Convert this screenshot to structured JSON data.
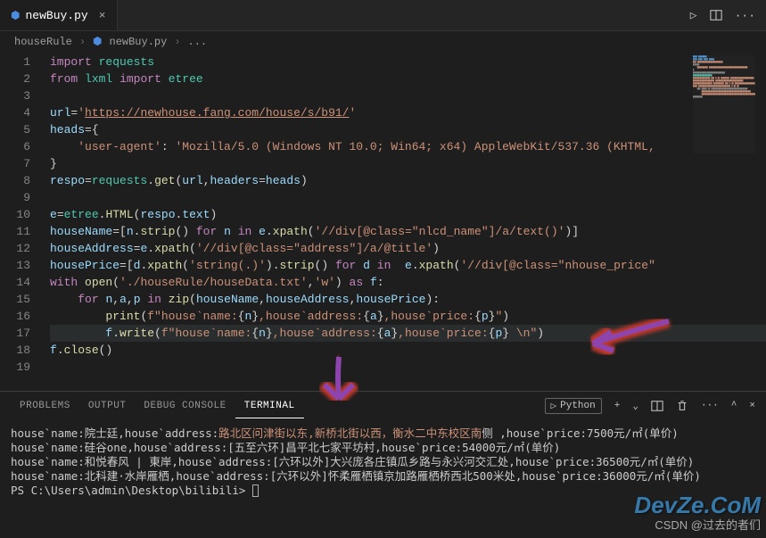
{
  "tab": {
    "filename": "newBuy.py",
    "icon": "python"
  },
  "breadcrumb": {
    "folder": "houseRule",
    "file": "newBuy.py",
    "suffix": "..."
  },
  "code": {
    "lines": [
      {
        "num": "1",
        "html": "<span class='k-import'>import</span> <span class='mod'>requests</span>"
      },
      {
        "num": "2",
        "html": "<span class='k-from'>from</span> <span class='mod'>lxml</span> <span class='k-import'>import</span> <span class='mod'>etree</span>"
      },
      {
        "num": "3",
        "html": ""
      },
      {
        "num": "4",
        "html": "<span class='var'>url</span>=<span class='s-string'>'</span><span class='s-url'>https://newhouse.fang.com/house/s/b91/</span><span class='s-string'>'</span>"
      },
      {
        "num": "5",
        "html": "<span class='var'>heads</span>={"
      },
      {
        "num": "6",
        "html": "    <span class='s-string'>'user-agent'</span>: <span class='s-string'>'Mozilla/5.0 (Windows NT 10.0; Win64; x64) AppleWebKit/537.36 (KHTML,</span>"
      },
      {
        "num": "7",
        "html": "}"
      },
      {
        "num": "8",
        "html": "<span class='var'>respo</span>=<span class='mod'>requests</span>.<span class='fn'>get</span>(<span class='var'>url</span>,<span class='var'>headers</span>=<span class='var'>heads</span>)"
      },
      {
        "num": "9",
        "html": ""
      },
      {
        "num": "10",
        "html": "<span class='var'>e</span>=<span class='mod'>etree</span>.<span class='fn'>HTML</span>(<span class='var'>respo</span>.<span class='var'>text</span>)"
      },
      {
        "num": "11",
        "html": "<span class='var'>houseName</span>=[<span class='var'>n</span>.<span class='fn'>strip</span>() <span class='k-for'>for</span> <span class='var'>n</span> <span class='k-in'>in</span> <span class='var'>e</span>.<span class='fn'>xpath</span>(<span class='s-string'>'//div[@class=\"nlcd_name\"]/a/text()'</span>)]"
      },
      {
        "num": "12",
        "html": "<span class='var'>houseAddress</span>=<span class='var'>e</span>.<span class='fn'>xpath</span>(<span class='s-string'>'//div[@class=\"address\"]/a/@title'</span>)"
      },
      {
        "num": "13",
        "html": "<span class='var'>housePrice</span>=[<span class='var'>d</span>.<span class='fn'>xpath</span>(<span class='s-string'>'string(.)'</span>).<span class='fn'>strip</span>() <span class='k-for'>for</span> <span class='var'>d</span> <span class='k-in'>in</span>  <span class='var'>e</span>.<span class='fn'>xpath</span>(<span class='s-string'>'//div[@class=\"nhouse_price\"</span>"
      },
      {
        "num": "14",
        "html": "<span class='k-with'>with</span> <span class='fn'>open</span>(<span class='s-string'>'./houseRule/houseData.txt'</span>,<span class='s-string'>'w'</span>) <span class='k-as'>as</span> <span class='var'>f</span>:"
      },
      {
        "num": "15",
        "html": "    <span class='k-for'>for</span> <span class='var'>n</span>,<span class='var'>a</span>,<span class='var'>p</span> <span class='k-in'>in</span> <span class='fn'>zip</span>(<span class='var'>houseName</span>,<span class='var'>houseAddress</span>,<span class='var'>housePrice</span>):"
      },
      {
        "num": "16",
        "html": "        <span class='fn'>print</span>(<span class='s-fstring'>f\"house`name:</span>{<span class='brace-var'>n</span>}<span class='s-fstring'>,house`address:</span>{<span class='brace-var'>a</span>}<span class='s-fstring'>,house`price:</span>{<span class='brace-var'>p</span>}<span class='s-fstring'>\"</span>)"
      },
      {
        "num": "17",
        "html": "        <span class='var'>f</span>.<span class='fn'>write</span>(<span class='s-fstring'>f\"house`name:</span>{<span class='brace-var'>n</span>}<span class='s-fstring'>,house`address:</span>{<span class='brace-var'>a</span>}<span class='s-fstring'>,house`price:</span>{<span class='brace-var'>p</span>}<span class='s-fstring'> \\n\"</span>)",
        "hl": true
      },
      {
        "num": "18",
        "html": "<span class='var'>f</span>.<span class='fn'>close</span>()"
      },
      {
        "num": "19",
        "html": ""
      }
    ]
  },
  "panel": {
    "tabs": {
      "problems": "PROBLEMS",
      "output": "OUTPUT",
      "debug": "DEBUG CONSOLE",
      "terminal": "TERMINAL"
    },
    "shell": "Python"
  },
  "terminal": {
    "lines": [
      "house`name:院士廷,house`address:<span class='t-hl'>路北区问津街以东,新桥北街以西，衡水二中东校区南</span>侧   ,house`price:7500元/㎡(单价)",
      "house`name:硅谷one,house`address:[五至六环]昌平北七家平坊村,house`price:54000元/㎡(单价)",
      "house`name:和悦春风 | 東岸,house`address:[六环以外]大兴庞各庄镇瓜乡路与永兴河交汇处,house`price:36500元/㎡(单价)",
      "house`name:北科建·水岸雁栖,house`address:[六环以外]怀柔雁栖镇京加路雁栖桥西北500米处,house`price:36000元/㎡(单价)"
    ],
    "prompt": "PS C:\\Users\\admin\\Desktop\\bilibili>"
  },
  "watermark": {
    "logo": "DevZe.CoM",
    "credit": "CSDN @过去的者们"
  }
}
